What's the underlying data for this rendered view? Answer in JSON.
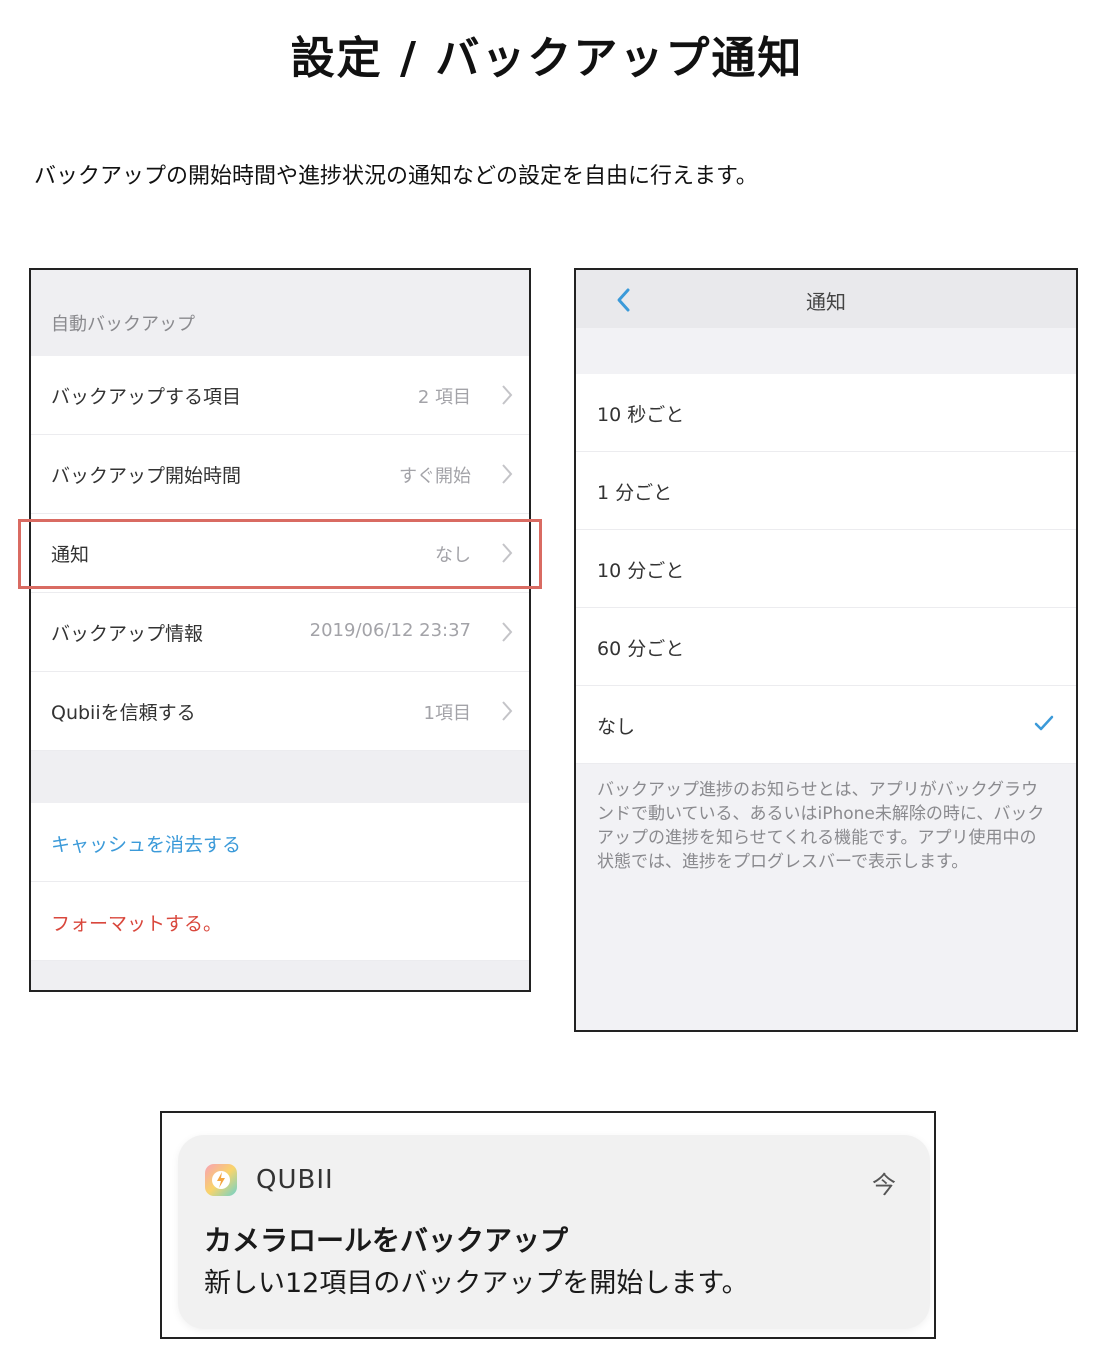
{
  "page": {
    "title": "設定 / バックアップ通知",
    "intro": "バックアップの開始時間や進捗状況の通知などの設定を自由に行えます。"
  },
  "settings": {
    "section_header": "自動バックアップ",
    "rows": [
      {
        "label": "バックアップする項目",
        "value": "2 項目"
      },
      {
        "label": "バックアップ開始時間",
        "value": "すぐ開始"
      },
      {
        "label": "通知",
        "value": "なし"
      },
      {
        "label": "バックアップ情報",
        "value": "2019/06/12 23:37"
      },
      {
        "label": "Qubiiを信頼する",
        "value": "1項目"
      }
    ],
    "clear_cache_label": "キャッシュを消去する",
    "format_label": "フォーマットする。"
  },
  "notification_settings": {
    "title": "通知",
    "options": [
      {
        "label": "10 秒ごと",
        "selected": false
      },
      {
        "label": "1 分ごと",
        "selected": false
      },
      {
        "label": "10 分ごと",
        "selected": false
      },
      {
        "label": "60 分ごと",
        "selected": false
      },
      {
        "label": "なし",
        "selected": true
      }
    ],
    "note": "バックアップ進捗のお知らせとは、アプリがバックグラウンドで動いている、あるいはiPhone未解除の時に、バックアップの進捗を知らせてくれる機能です。アプリ使用中の状態では、進捗をプログレスバーで表示します。"
  },
  "push_notification": {
    "app_name": "QUBII",
    "time": "今",
    "title": "カメラロールをバックアップ",
    "body": "新しい12項目のバックアップを開始します。"
  },
  "colors": {
    "accent_blue": "#3b9ad9",
    "danger_red": "#d9473c",
    "highlight_red": "#d96b62"
  }
}
